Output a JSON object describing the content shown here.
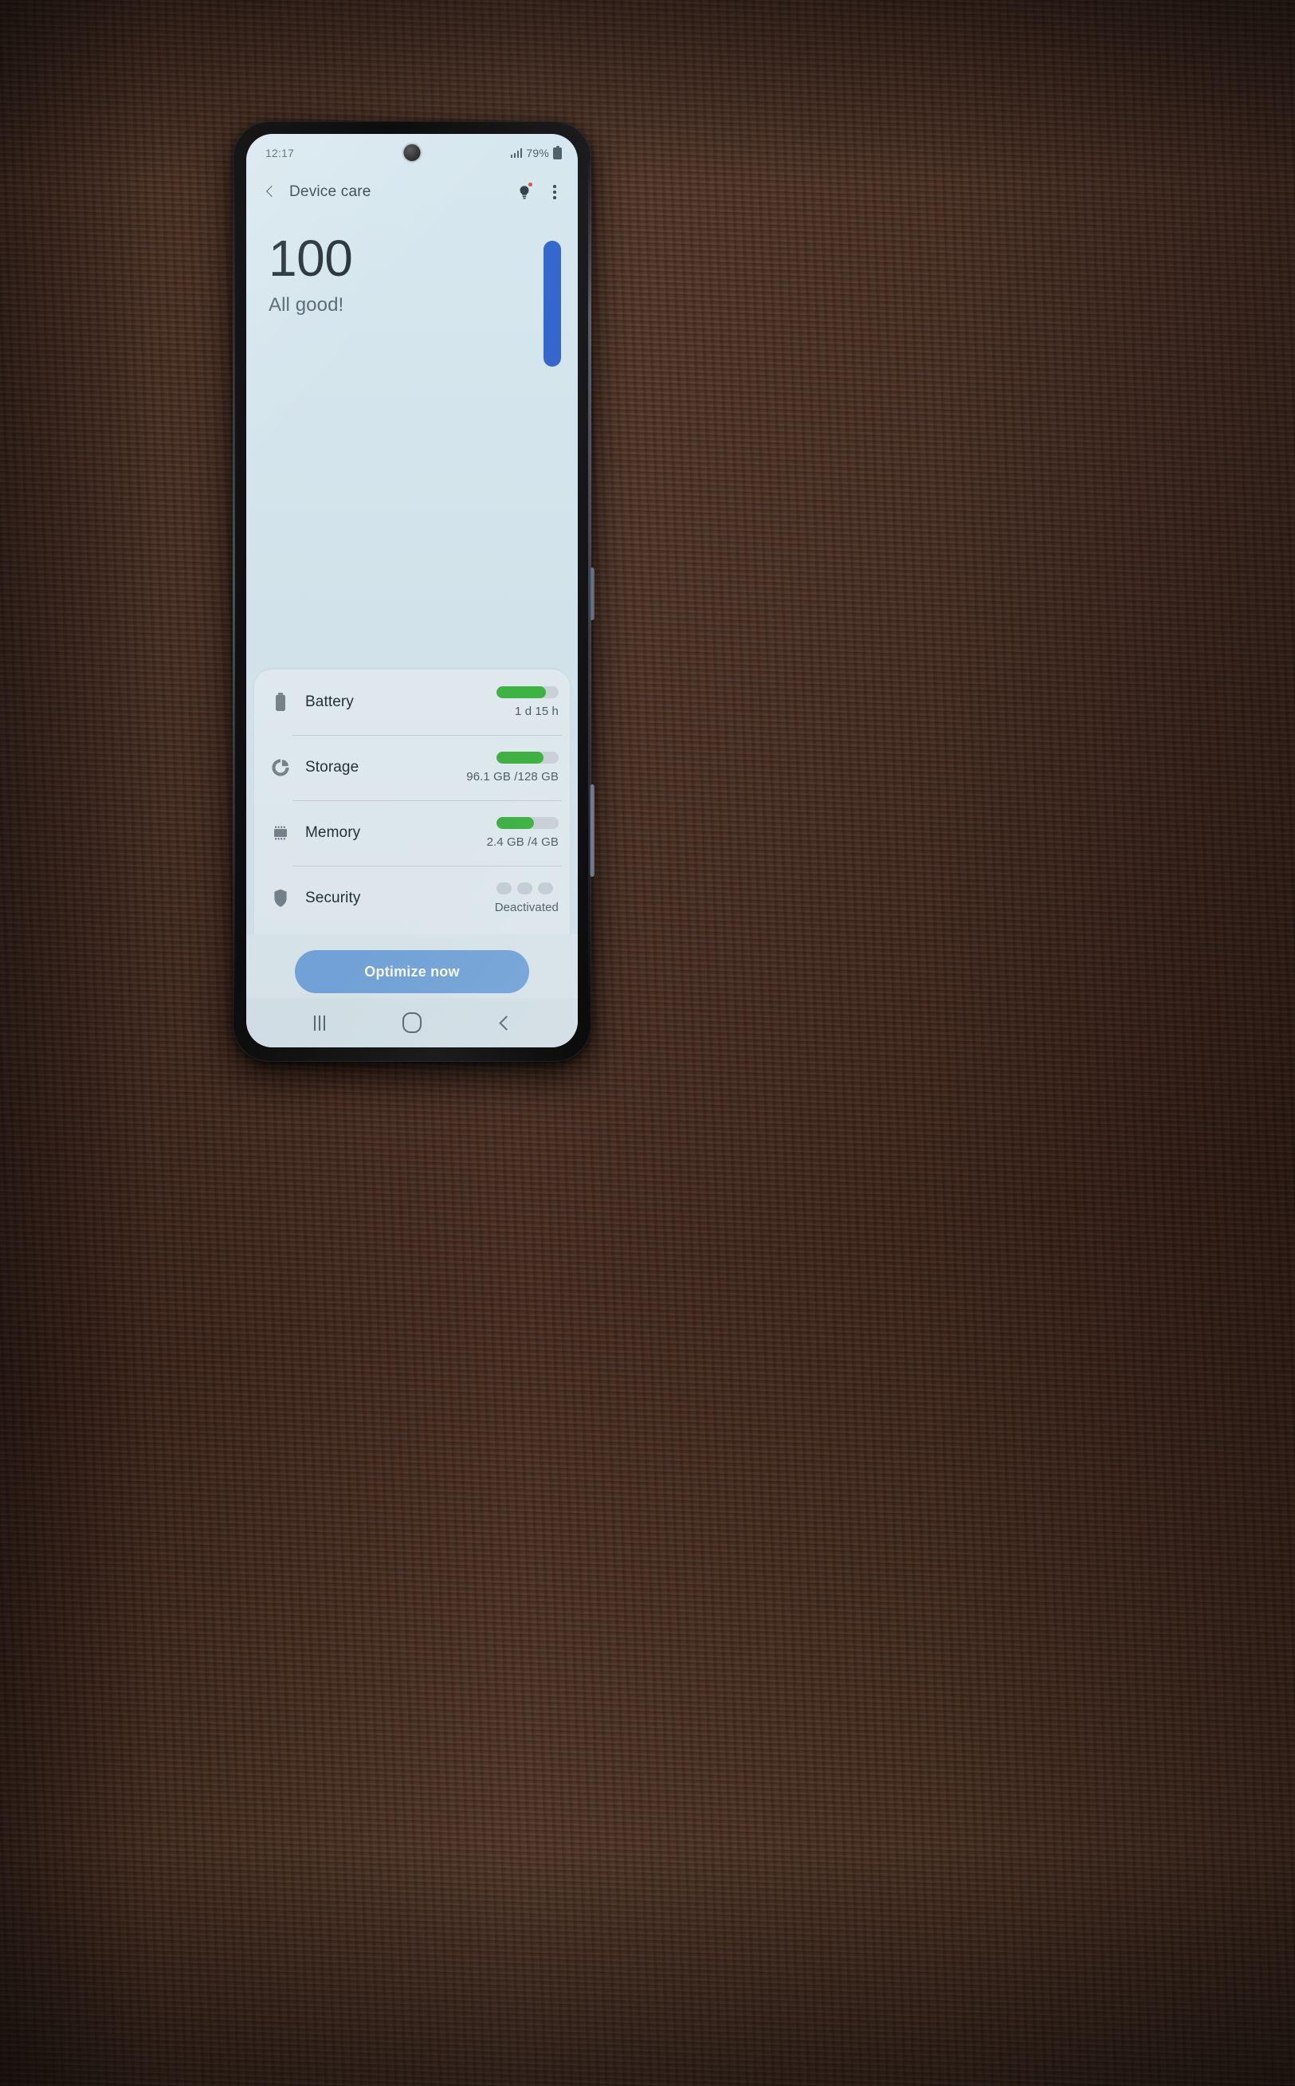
{
  "status_bar": {
    "time": "12:17",
    "battery_percent": "79%",
    "signal_icon": "signal-bars-icon",
    "battery_icon": "battery-icon"
  },
  "app_bar": {
    "back_icon": "back-chevron-icon",
    "title": "Device care",
    "tips_icon": "lightbulb-icon",
    "tips_has_badge": true,
    "menu_icon": "more-vertical-icon"
  },
  "hero": {
    "score": "100",
    "status_text": "All good!",
    "scrollbar": "scrollbar-thumb"
  },
  "card": {
    "rows": [
      {
        "id": "battery",
        "icon": "battery-icon",
        "label": "Battery",
        "value": "1 d 15 h",
        "bar_percent": 80,
        "indicator": "bar"
      },
      {
        "id": "storage",
        "icon": "storage-pie-icon",
        "label": "Storage",
        "value": "96.1 GB /128 GB",
        "bar_percent": 76,
        "indicator": "bar"
      },
      {
        "id": "memory",
        "icon": "memory-chip-icon",
        "label": "Memory",
        "value": "2.4 GB /4 GB",
        "bar_percent": 60,
        "indicator": "bar"
      },
      {
        "id": "security",
        "icon": "shield-icon",
        "label": "Security",
        "value": "Deactivated",
        "bar_percent": 0,
        "indicator": "dots"
      }
    ]
  },
  "footer": {
    "optimize_label": "Optimize now"
  },
  "nav_bar": {
    "recents_icon": "recents-icon",
    "home_icon": "home-icon",
    "back_icon": "back-icon"
  },
  "colors": {
    "screen_bg": "#d5e6ee",
    "card_bg": "#e2edf2",
    "accent_blue": "#2c61cc",
    "button_blue": "#74a6dd",
    "progress_green": "#3cb441",
    "progress_track": "#cbd5db",
    "badge_red": "#e0483c",
    "background_wood": "#4a3023"
  }
}
